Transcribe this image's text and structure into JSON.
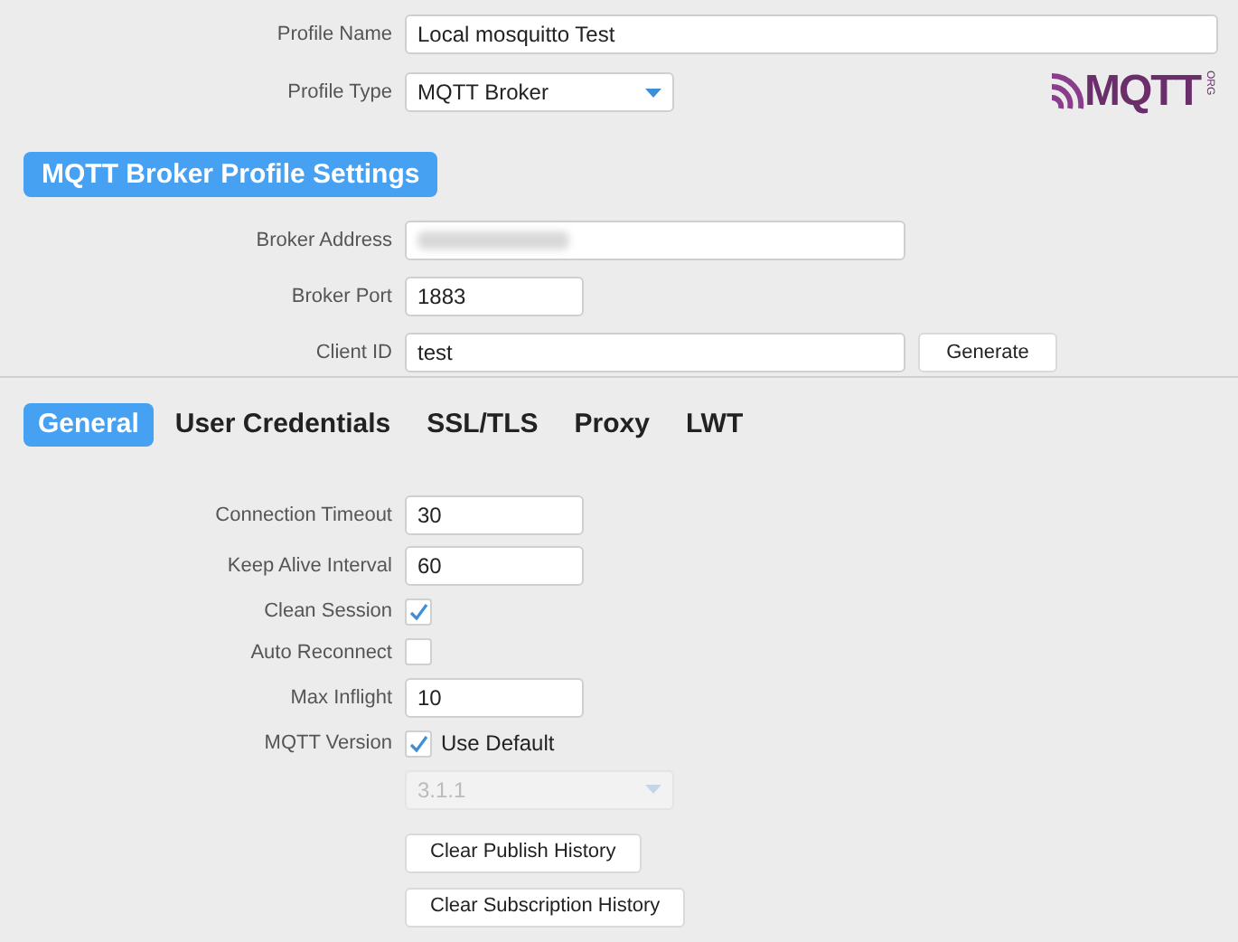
{
  "profile": {
    "name_label": "Profile Name",
    "name_value": "Local mosquitto Test",
    "type_label": "Profile Type",
    "type_value": "MQTT Broker"
  },
  "logo": {
    "text": "MQTT",
    "suffix": "ORG"
  },
  "section_title": "MQTT Broker Profile Settings",
  "broker": {
    "address_label": "Broker Address",
    "address_blurred": true,
    "port_label": "Broker Port",
    "port_value": "1883",
    "client_label": "Client ID",
    "client_value": "test",
    "generate_button": "Generate"
  },
  "tabs": [
    {
      "label": "General",
      "selected": true
    },
    {
      "label": "User Credentials",
      "selected": false
    },
    {
      "label": "SSL/TLS",
      "selected": false
    },
    {
      "label": "Proxy",
      "selected": false
    },
    {
      "label": "LWT",
      "selected": false
    }
  ],
  "general": [
    {
      "kind": "text",
      "label": "Connection Timeout",
      "value": "30"
    },
    {
      "kind": "text",
      "label": "Keep Alive Interval",
      "value": "60"
    },
    {
      "kind": "checkbox",
      "label": "Clean Session",
      "checked": true
    },
    {
      "kind": "checkbox",
      "label": "Auto Reconnect",
      "checked": false
    },
    {
      "kind": "text",
      "label": "Max Inflight",
      "value": "10"
    },
    {
      "kind": "checkbox",
      "label": "MQTT Version",
      "checked": true,
      "text": "Use Default"
    }
  ],
  "version_select": {
    "value": "3.1.1",
    "disabled": true
  },
  "buttons": [
    "Clear Publish History",
    "Clear Subscription History"
  ]
}
